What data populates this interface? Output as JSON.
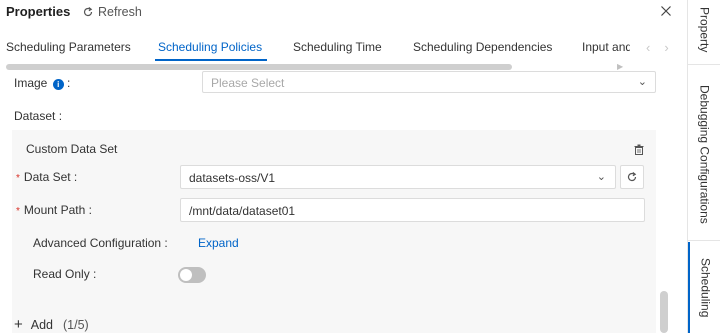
{
  "header": {
    "title": "Properties",
    "refresh_label": "Refresh"
  },
  "tabs": [
    {
      "label": "Scheduling Parameters",
      "active": false
    },
    {
      "label": "Scheduling Policies",
      "active": true
    },
    {
      "label": "Scheduling Time",
      "active": false
    },
    {
      "label": "Scheduling Dependencies",
      "active": false
    },
    {
      "label": "Input and",
      "active": false
    }
  ],
  "form": {
    "image_label": "Image",
    "image_colon": ":",
    "image_placeholder": "Please Select",
    "dataset_label": "Dataset :",
    "custom_data_set_title": "Custom Data Set",
    "data_set_label": "Data Set :",
    "data_set_value": "datasets-oss/V1",
    "mount_path_label": "Mount Path :",
    "mount_path_value": "/mnt/data/dataset01",
    "advanced_config_label": "Advanced Configuration :",
    "expand_link": "Expand",
    "read_only_label": "Read Only :",
    "read_only_enabled": false,
    "required_marker": "*",
    "add_label": "Add",
    "add_count": "(1/5)"
  },
  "right_rail": [
    {
      "label": "Property",
      "active": false
    },
    {
      "label": "Debugging Configurations",
      "active": false
    },
    {
      "label": "Scheduling",
      "active": true
    }
  ],
  "colors": {
    "accent": "#0064c8",
    "required": "#d93026",
    "section_bg": "#f7f7f7"
  },
  "icons": [
    "refresh-icon",
    "close-icon",
    "info-icon",
    "chevron-down-icon",
    "trash-icon",
    "refresh-icon",
    "plus-icon",
    "chevron-left-icon",
    "chevron-right-icon"
  ]
}
